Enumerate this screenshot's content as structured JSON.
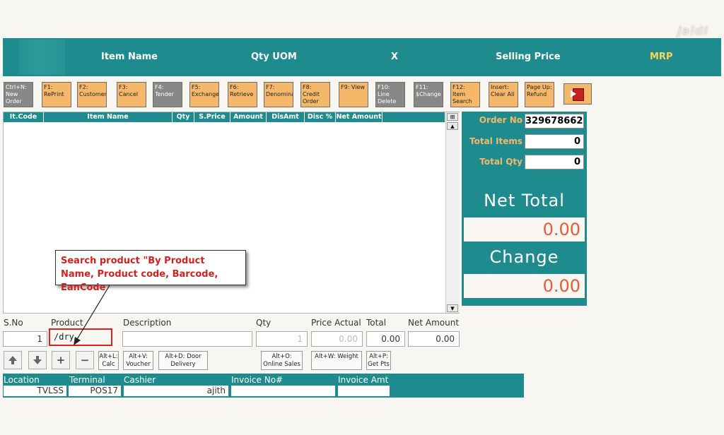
{
  "header": {
    "columns": [
      "Item Name",
      "Qty UOM",
      "X",
      "Selling Price",
      "MRP"
    ],
    "logo_text": "jaldi",
    "accent_color": "#1e8c8e",
    "mrp_color": "#f5d65a"
  },
  "toolbar": [
    {
      "label": "Ctrl+N: New Order",
      "style": "gray"
    },
    {
      "label": "F1: RePrint",
      "style": "orange"
    },
    {
      "label": "F2: Customer",
      "style": "orange"
    },
    {
      "label": "F3: Cancel",
      "style": "orange"
    },
    {
      "label": "F4: Tender",
      "style": "gray"
    },
    {
      "label": "F5: Exchange",
      "style": "orange"
    },
    {
      "label": "F6: Retrieve",
      "style": "orange"
    },
    {
      "label": "F7: Denomina",
      "style": "orange"
    },
    {
      "label": "F8: Credit Order",
      "style": "orange"
    },
    {
      "label": "F9: View",
      "style": "orange"
    },
    {
      "label": "F10: Line Delete",
      "style": "gray"
    },
    {
      "label": "F11: $Change",
      "style": "gray"
    },
    {
      "label": "F12: Item Search",
      "style": "orange"
    },
    {
      "label": "Insert: Clear All",
      "style": "orange"
    },
    {
      "label": "Page Up: Refund",
      "style": "orange"
    }
  ],
  "exit_icon": "exit-door-icon",
  "grid": {
    "columns": [
      "It.Code",
      "Item Name",
      "Qty",
      "S.Price",
      "Amount",
      "DisAmt",
      "Disc %",
      "Net Amount"
    ],
    "corner_icon": "column-chooser-icon",
    "scroll_up": "▲",
    "scroll_down": "▼"
  },
  "summary": {
    "order_no_label": "Order No",
    "order_no": "329678662",
    "total_items_label": "Total Items",
    "total_items": "0",
    "total_qty_label": "Total Qty",
    "total_qty": "0",
    "net_total_label": "Net Total",
    "net_total": "0.00",
    "change_label": "Change",
    "change": "0.00"
  },
  "entry": {
    "sno_label": "S.No",
    "sno": "1",
    "product_label": "Product",
    "product_value": "/dry",
    "description_label": "Description",
    "description": "",
    "qty_label": "Qty",
    "qty": "1",
    "price_label": "Price Actual",
    "price": "0.00",
    "total_label": "Total",
    "total": "0.00",
    "net_label": "Net Amount",
    "net": "0.00"
  },
  "action_buttons": [
    {
      "label": "Alt+L: Calc"
    },
    {
      "label": "Alt+V: Voucher"
    },
    {
      "label": "Alt+D: Door Delivery"
    },
    {
      "label": "Alt+O: Online Sales"
    },
    {
      "label": "Alt+W: Weight"
    },
    {
      "label": "Alt+P: Get Pts"
    }
  ],
  "footer": {
    "location_label": "Location",
    "location": "TVLSS",
    "terminal_label": "Terminal",
    "terminal": "POS17",
    "cashier_label": "Cashier",
    "cashier": "ajith",
    "invoice_no_label": "Invoice No#",
    "invoice_no": "",
    "invoice_amt_label": "Invoice Amt",
    "invoice_amt": ""
  },
  "annotation": {
    "text": "Search product \"By Product Name, Product code, Barcode, EanCode",
    "color": "#d61f1f"
  }
}
